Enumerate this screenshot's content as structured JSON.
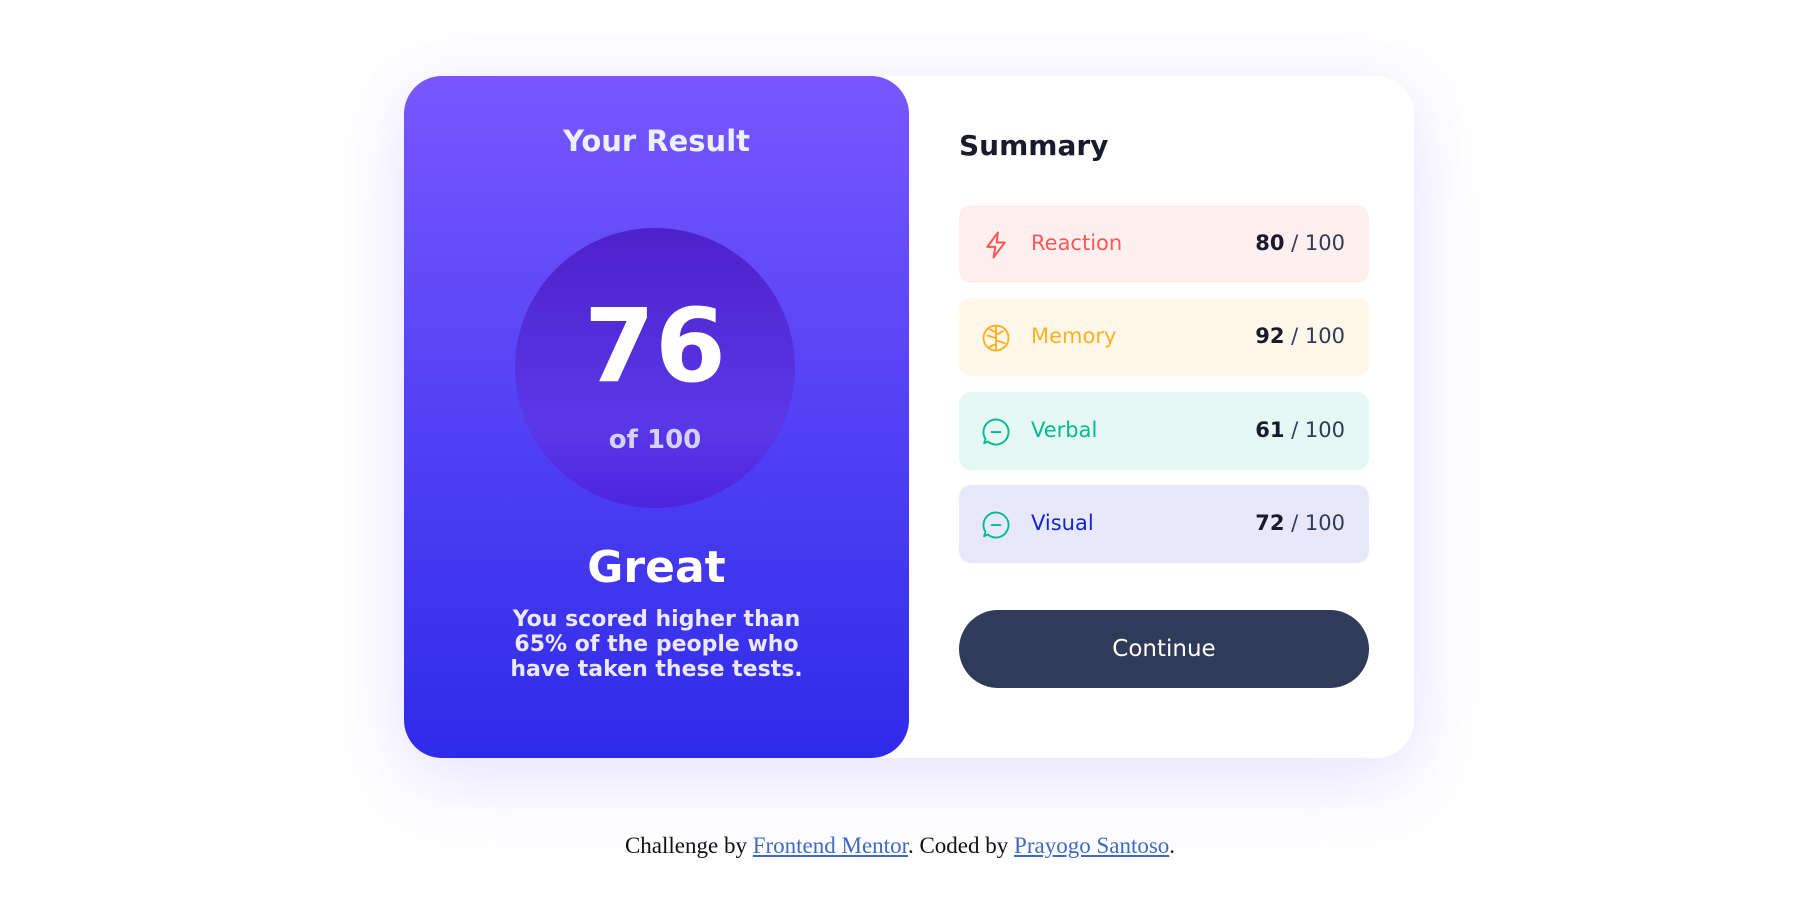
{
  "result": {
    "heading": "Your Result",
    "score": "76",
    "score_total": "of 100",
    "rating": "Great",
    "description": "You scored higher than 65% of the people who have taken these tests."
  },
  "summary": {
    "title": "Summary",
    "items": [
      {
        "label": "Reaction",
        "score": "80",
        "separator": "/ 100",
        "icon": "lightning-icon",
        "color": "#ff5757"
      },
      {
        "label": "Memory",
        "score": "92",
        "separator": "/ 100",
        "icon": "brain-icon",
        "color": "#ffb01f"
      },
      {
        "label": "Verbal",
        "score": "61",
        "separator": "/ 100",
        "icon": "chat-bubble-icon",
        "color": "#00bb8f"
      },
      {
        "label": "Visual",
        "score": "72",
        "separator": "/ 100",
        "icon": "chat-bubble-icon",
        "color": "#1125d6"
      }
    ],
    "button_label": "Continue"
  },
  "attribution": {
    "prefix": "Challenge by ",
    "link1": "Frontend Mentor",
    "middle": ". Coded by ",
    "link2": "Prayogo Santoso",
    "suffix": "."
  }
}
